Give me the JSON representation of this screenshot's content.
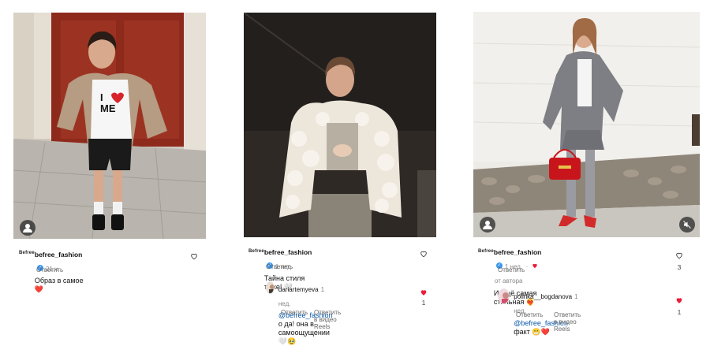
{
  "posts": [
    {
      "brand_logo": "Befree",
      "username": "befree_fashion",
      "time": "21 ч.",
      "text": "Образ в самое",
      "emoji": "❤️",
      "reply": "Ответить"
    },
    {
      "brand_logo": "Befree",
      "username": "befree_fashion",
      "time": "1 нед.",
      "text": "Тайна стиля тоже!",
      "emoji": "🤍",
      "reply": "Ответить",
      "subcomment": {
        "username": "dariartemyeva",
        "time": "1 нед.",
        "mention": "@befree_fashion",
        "text_line1": "о да! она в",
        "text_line2": "самоощущении",
        "emoji": "🤍🥹",
        "reply": "Ответить",
        "reply_reels": "Ответить в видео Reels",
        "likes": "1"
      }
    },
    {
      "brand_logo": "Befree",
      "username": "befree_fashion",
      "time": "1 нед.",
      "author_note": "от автора",
      "text": "И ещё самая стильная",
      "emoji": "❤️‍🔥",
      "reply": "Ответить",
      "likes": "3",
      "subcomment": {
        "username": "polinka__bogdanova",
        "time": "1 нед.",
        "mention": "@befree_fashion",
        "text": "факт",
        "emoji": "😁❤️",
        "reply": "Ответить",
        "reply_reels": "Ответить в видео Reels",
        "likes": "1"
      }
    }
  ],
  "colors": {
    "like_red": "#ed1c3a",
    "verified": "#3897f0",
    "mention": "#0a58a8"
  }
}
